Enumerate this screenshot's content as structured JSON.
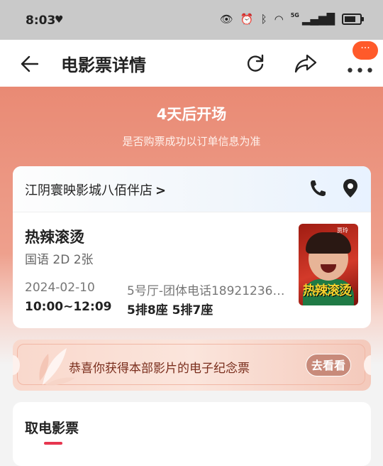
{
  "status_bar": {
    "time": "8:03",
    "network_label": "5G"
  },
  "nav": {
    "title": "电影票详情",
    "more_badge": "···"
  },
  "hero": {
    "countdown": "4天后开场",
    "notice": "是否购票成功以订单信息为准"
  },
  "cinema": {
    "name": "江阴寰映影城八佰伴店",
    "chevron": ">"
  },
  "movie": {
    "title": "热辣滚烫",
    "meta": "国语 2D 2张",
    "date": "2024-02-10",
    "time": "10:00~12:09",
    "hall": "5号厅-团体电话18921236…",
    "seats": "5排8座  5排7座",
    "poster_title": "热辣滚烫",
    "poster_tag": "贾玲"
  },
  "souvenir": {
    "text": "恭喜你获得本部影片的电子纪念票",
    "button": "去看看"
  },
  "pickup": {
    "title": "取电影票"
  },
  "colors": {
    "accent": "#e7364f",
    "hero_top": "#e98a74",
    "badge": "#ff5a2a"
  }
}
